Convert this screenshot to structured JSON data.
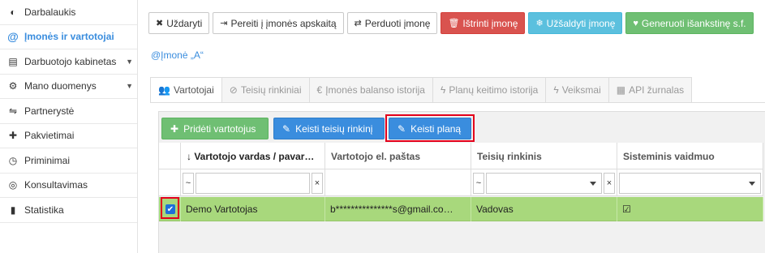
{
  "sidebar": {
    "items": [
      {
        "label": "Darbalaukis",
        "icon": "dashboard-icon",
        "glyph": "◐"
      },
      {
        "label": "Įmonės ir vartotojai",
        "icon": "at-icon",
        "glyph": "@"
      },
      {
        "label": "Darbuotojo kabinetas",
        "icon": "id-card-icon",
        "glyph": "▤"
      },
      {
        "label": "Mano duomenys",
        "icon": "cogs-icon",
        "glyph": "⚙"
      },
      {
        "label": "Partnerystė",
        "icon": "handshake-icon",
        "glyph": "⇋"
      },
      {
        "label": "Pakvietimai",
        "icon": "user-plus-icon",
        "glyph": "✚"
      },
      {
        "label": "Priminimai",
        "icon": "clock-icon",
        "glyph": "◷"
      },
      {
        "label": "Konsultavimas",
        "icon": "lifebuoy-icon",
        "glyph": "◎"
      },
      {
        "label": "Statistika",
        "icon": "bar-chart-icon",
        "glyph": "▮"
      }
    ]
  },
  "toolbar": {
    "close": "Uždaryti",
    "goto_accounting": "Pereiti į įmonės apskaitą",
    "transfer": "Perduoti įmonę",
    "delete": "Ištrinti įmonę",
    "freeze": "Užšaldyti įmonę",
    "prepay": "Generuoti išankstinę s.f."
  },
  "company": {
    "name": "@Įmonė „A“"
  },
  "tabs": [
    {
      "label": "Vartotojai",
      "glyph": "👥"
    },
    {
      "label": "Teisių rinkiniai",
      "glyph": "⊘"
    },
    {
      "label": "Įmonės balanso istorija",
      "glyph": "€"
    },
    {
      "label": "Planų keitimo istorija",
      "glyph": "ϟ"
    },
    {
      "label": "Veiksmai",
      "glyph": "ϟ"
    },
    {
      "label": "API žurnalas",
      "glyph": "▦"
    }
  ],
  "actions": {
    "add_user": "Pridėti vartotojus",
    "change_rights": "Keisti teisių rinkinį",
    "change_plan": "Keisti planą"
  },
  "table": {
    "columns": [
      "↓ Vartotojo vardas / pavar…",
      "Vartotojo el. paštas",
      "Teisių rinkinis",
      "Sisteminis vaidmuo"
    ],
    "filter_tilde": "~",
    "filter_clear": "×",
    "rows": [
      {
        "name": "Demo Vartotojas",
        "email": "b***************s@gmail.co…",
        "rights": "Vadovas",
        "role_check": "☑"
      }
    ]
  }
}
